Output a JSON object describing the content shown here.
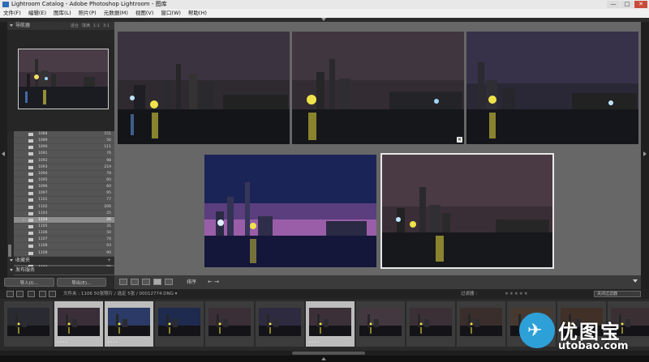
{
  "window": {
    "title": "Lightroom Catalog - Adobe Photoshop Lightroom - 图库",
    "buttons": [
      "—",
      "□",
      "✕"
    ]
  },
  "menu": [
    "文件(F)",
    "编辑(E)",
    "图库(L)",
    "照片(P)",
    "元数据(M)",
    "视图(V)",
    "窗口(W)",
    "帮助(H)"
  ],
  "left_panel": {
    "navigator": {
      "title": "导航器",
      "options": [
        "适合",
        "填满",
        "1:1",
        "3:1"
      ]
    },
    "folders": [
      {
        "name": "1088",
        "count": "151"
      },
      {
        "name": "1089",
        "count": "56"
      },
      {
        "name": "1090",
        "count": "111"
      },
      {
        "name": "1091",
        "count": "76"
      },
      {
        "name": "1092",
        "count": "98"
      },
      {
        "name": "1093",
        "count": "219"
      },
      {
        "name": "1094",
        "count": "78"
      },
      {
        "name": "1095",
        "count": "60"
      },
      {
        "name": "1096",
        "count": "60"
      },
      {
        "name": "1097",
        "count": "95"
      },
      {
        "name": "1101",
        "count": "77"
      },
      {
        "name": "1102",
        "count": "206"
      },
      {
        "name": "1103",
        "count": "25"
      },
      {
        "name": "1104",
        "count": "26"
      },
      {
        "name": "1105",
        "count": "31"
      },
      {
        "name": "1106",
        "count": "50"
      },
      {
        "name": "1107",
        "count": "74"
      },
      {
        "name": "1108",
        "count": "93"
      },
      {
        "name": "1109",
        "count": "90"
      },
      {
        "name": "1110",
        "count": "120"
      },
      {
        "name": "1111",
        "count": "41"
      }
    ],
    "selected_folder_index": 13,
    "collections_title": "收藏夹",
    "publish_title": "发布服务",
    "import_button": "导入(I)...",
    "export_button": "导出(E)..."
  },
  "toolbar": {
    "sort_label": "排序",
    "arrows": "← →"
  },
  "film_info": {
    "path": "文件夹 : 1106   50张照片 / 选定 5张 / 00012774.DNG ▾",
    "filter_label": "过滤器 :",
    "stars": "★★★★★",
    "filter_value": "关闭过滤器"
  },
  "watermark": {
    "cn": "优图宝",
    "url": "utobao.com"
  },
  "colors": {
    "panel_bg": "#2a2a2a",
    "grid_bg": "#676767",
    "selected_folder": "#8e8e8e",
    "watermark_blue": "#2da0d8"
  }
}
